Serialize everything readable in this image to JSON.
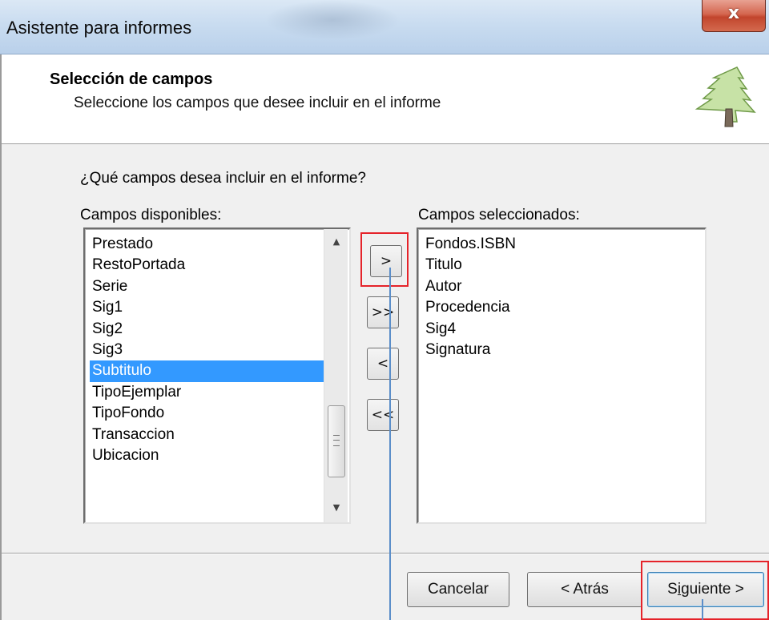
{
  "window": {
    "title": "Asistente para informes",
    "close_label": "x"
  },
  "header": {
    "title": "Selección de campos",
    "subtitle": "Seleccione los campos que desee incluir en el informe",
    "icon": "tree-icon"
  },
  "body": {
    "question": "¿Qué campos desea incluir en el informe?",
    "available_label": "Campos disponibles:",
    "selected_label": "Campos seleccionados:"
  },
  "available_fields": {
    "items": [
      "Prestado",
      "RestoPortada",
      "Serie",
      "Sig1",
      "Sig2",
      "Sig3",
      "Subtitulo",
      "TipoEjemplar",
      "TipoFondo",
      "Transaccion",
      "Ubicacion"
    ],
    "selected_item": "Subtitulo"
  },
  "selected_fields": {
    "items": [
      "Fondos.ISBN",
      "Titulo",
      "Autor",
      "Procedencia",
      "Sig4",
      "Signatura"
    ]
  },
  "transfer_buttons": {
    "add_one": ">",
    "add_all": ">>",
    "remove_one": "<",
    "remove_all": "<<"
  },
  "footer": {
    "cancel": "Cancelar",
    "back": "< Atrás",
    "next_prefix": "S",
    "next_underlined": "i",
    "next_suffix": "guiente >"
  },
  "colors": {
    "selection": "#3399ff",
    "annotation_highlight": "#e5232a",
    "annotation_line": "#5b8ec9",
    "close_button": "#c2452d"
  }
}
